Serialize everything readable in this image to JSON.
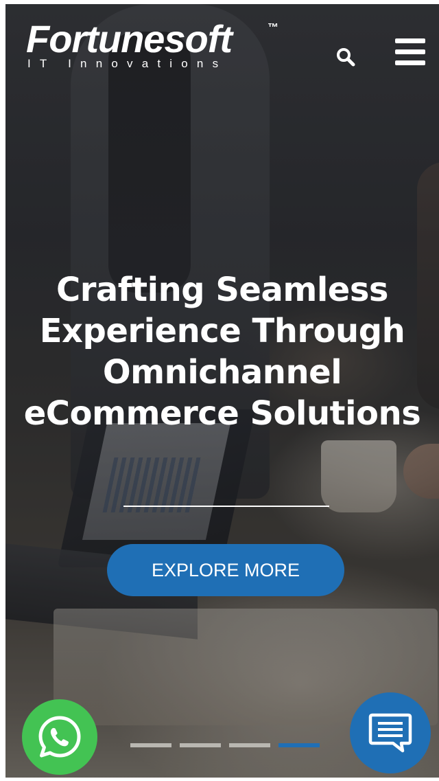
{
  "header": {
    "logo_main": "Fortunesoft",
    "logo_tm": "™",
    "logo_sub": "IT Innovations",
    "search_icon": "search-icon",
    "menu_icon": "hamburger-menu-icon"
  },
  "hero": {
    "headline_lines": [
      "Crafting Seamless",
      "Experience Through",
      "Omnichannel",
      "eCommerce Solutions"
    ],
    "cta_label": "EXPLORE MORE"
  },
  "carousel": {
    "slide_count": 4,
    "active_index": 3
  },
  "floating": {
    "whatsapp_icon": "whatsapp-icon",
    "chat_icon": "chat-message-icon"
  },
  "colors": {
    "accent_blue": "#1f6fb5",
    "whatsapp_green": "#43c353",
    "dot_inactive": "#b9b7b1",
    "text_white": "#ffffff"
  }
}
